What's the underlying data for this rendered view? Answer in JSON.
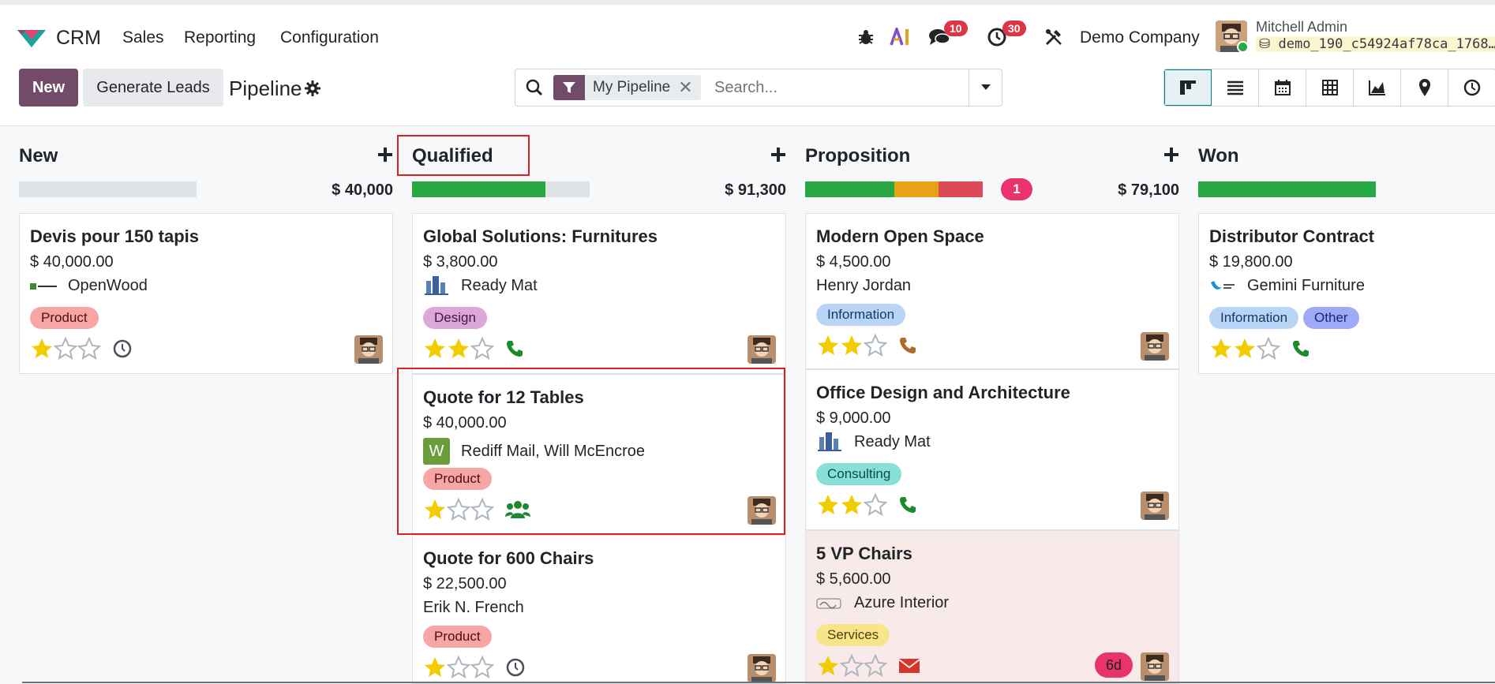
{
  "navbar": {
    "app_name": "CRM",
    "menu": [
      "Sales",
      "Reporting",
      "Configuration"
    ],
    "messages_count": "10",
    "activities_count": "30",
    "company": "Demo Company",
    "user_name": "Mitchell Admin",
    "database": "demo_190_c54924af78ca_1768…"
  },
  "control": {
    "new_label": "New",
    "generate_label": "Generate Leads",
    "title": "Pipeline",
    "facet_label": "My Pipeline",
    "search_placeholder": "Search...",
    "views": [
      "kanban",
      "list",
      "calendar",
      "pivot",
      "graph",
      "map",
      "activity"
    ]
  },
  "columns": [
    {
      "title": "New",
      "total": "$ 40,000",
      "cards": [
        {
          "title": "Devis pour 150 tapis",
          "amount": "$ 40,000.00",
          "partner": "OpenWood",
          "tags": [
            "Product"
          ],
          "stars": 1,
          "activity": "clock"
        }
      ]
    },
    {
      "title": "Qualified",
      "total": "$ 91,300",
      "cards": [
        {
          "title": "Global Solutions: Furnitures",
          "amount": "$ 3,800.00",
          "partner": "Ready Mat",
          "tags": [
            "Design"
          ],
          "stars": 2,
          "activity": "phone"
        },
        {
          "title": "Quote for 12 Tables",
          "amount": "$ 40,000.00",
          "partner_initial": "W",
          "partner": "Rediff Mail, Will McEncroe",
          "tags": [
            "Product"
          ],
          "stars": 1,
          "activity": "meeting"
        },
        {
          "title": "Quote for 600 Chairs",
          "amount": "$ 22,500.00",
          "partner": "Erik N. French",
          "tags": [
            "Product"
          ],
          "stars": 1,
          "activity": "clock"
        }
      ]
    },
    {
      "title": "Proposition",
      "total": "$ 79,100",
      "count_badge": "1",
      "cards": [
        {
          "title": "Modern Open Space",
          "amount": "$ 4,500.00",
          "partner": "Henry Jordan",
          "tags": [
            "Information"
          ],
          "stars": 2,
          "activity": "phone"
        },
        {
          "title": "Office Design and Architecture",
          "amount": "$ 9,000.00",
          "partner": "Ready Mat",
          "tags": [
            "Consulting"
          ],
          "stars": 2,
          "activity": "phone"
        },
        {
          "title": "5 VP Chairs",
          "amount": "$ 5,600.00",
          "partner": "Azure Interior",
          "tags": [
            "Services"
          ],
          "stars": 1,
          "activity": "email",
          "late": "6d"
        }
      ]
    },
    {
      "title": "Won",
      "total": "$",
      "cards": [
        {
          "title": "Distributor Contract",
          "amount": "$ 19,800.00",
          "partner": "Gemini Furniture",
          "tags": [
            "Information",
            "Other"
          ],
          "stars": 2,
          "activity": "phone"
        }
      ]
    }
  ],
  "colors": {
    "brand": "#714b67",
    "progress_green": "#28a745",
    "progress_orange": "#e8a21a",
    "progress_red": "#dc4a55",
    "highlight": "#e02020"
  }
}
